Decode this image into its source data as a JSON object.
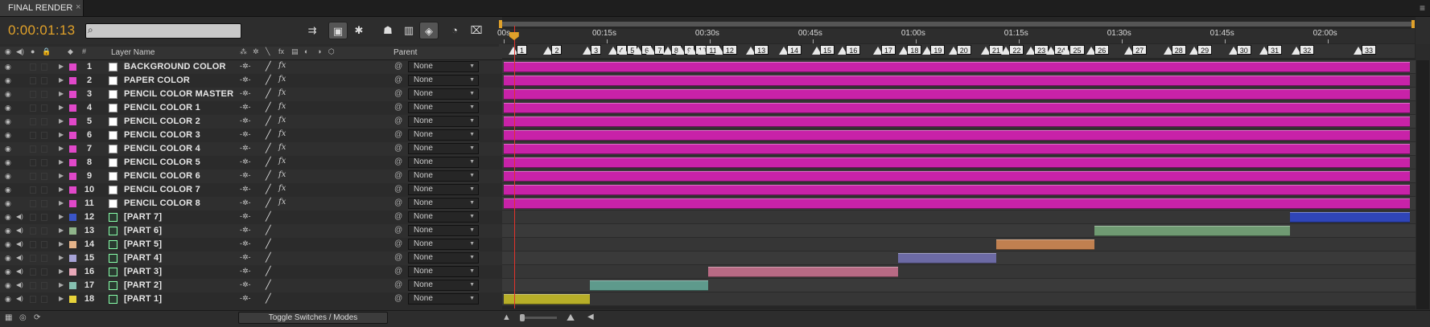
{
  "tab": {
    "title": "FINAL RENDER",
    "close": "×"
  },
  "panel_menu": "≡",
  "timecode": "0:00:01:13",
  "search": {
    "placeholder": ""
  },
  "columns": {
    "layer_name": "Layer Name",
    "parent": "Parent"
  },
  "toolbar": {
    "icons": [
      "comp-mini-flowchart-icon",
      "draft-3d-icon",
      "shy-icon",
      "frame-blending-icon",
      "motion-blur-icon",
      "brainstorm-icon",
      "graph-editor-icon"
    ]
  },
  "ruler": {
    "ticks": [
      "00s",
      "00:15s",
      "00:30s",
      "00:45s",
      "01:00s",
      "01:15s",
      "01:30s",
      "01:45s",
      "02:00s"
    ],
    "markers": [
      "1",
      "2",
      "3",
      "4",
      "5",
      "6",
      "7",
      "8",
      "9",
      "10",
      "11",
      "12",
      "13",
      "14",
      "15",
      "16",
      "17",
      "18",
      "19",
      "20",
      "21",
      "22",
      "23",
      "24",
      "25",
      "26",
      "27",
      "28",
      "29",
      "30",
      "31",
      "32",
      "33"
    ]
  },
  "layers": [
    {
      "num": "1",
      "name": "BACKGROUND COLOR",
      "label": "#e048c9",
      "type": "solid",
      "fx": "fx",
      "parent": "None"
    },
    {
      "num": "2",
      "name": "PAPER COLOR",
      "label": "#e048c9",
      "type": "solid",
      "fx": "fx",
      "parent": "None"
    },
    {
      "num": "3",
      "name": "PENCIL COLOR MASTER",
      "label": "#e048c9",
      "type": "solid",
      "fx": "fx",
      "parent": "None"
    },
    {
      "num": "4",
      "name": "PENCIL COLOR 1",
      "label": "#e048c9",
      "type": "solid",
      "fx": "fx",
      "parent": "None"
    },
    {
      "num": "5",
      "name": "PENCIL COLOR 2",
      "label": "#e048c9",
      "type": "solid",
      "fx": "fx",
      "parent": "None"
    },
    {
      "num": "6",
      "name": "PENCIL COLOR 3",
      "label": "#e048c9",
      "type": "solid",
      "fx": "fx",
      "parent": "None"
    },
    {
      "num": "7",
      "name": "PENCIL COLOR 4",
      "label": "#e048c9",
      "type": "solid",
      "fx": "fx",
      "parent": "None"
    },
    {
      "num": "8",
      "name": "PENCIL COLOR 5",
      "label": "#e048c9",
      "type": "solid",
      "fx": "fx",
      "parent": "None"
    },
    {
      "num": "9",
      "name": "PENCIL COLOR 6",
      "label": "#e048c9",
      "type": "solid",
      "fx": "fx",
      "parent": "None"
    },
    {
      "num": "10",
      "name": "PENCIL COLOR 7",
      "label": "#e048c9",
      "type": "solid",
      "fx": "fx",
      "parent": "None"
    },
    {
      "num": "11",
      "name": "PENCIL COLOR 8",
      "label": "#e048c9",
      "type": "solid",
      "fx": "fx",
      "parent": "None"
    },
    {
      "num": "12",
      "name": "[PART 7]",
      "label": "#3a55c8",
      "type": "comp",
      "fx": "",
      "parent": "None"
    },
    {
      "num": "13",
      "name": "[PART 6]",
      "label": "#8fb48a",
      "type": "comp",
      "fx": "",
      "parent": "None"
    },
    {
      "num": "14",
      "name": "[PART 5]",
      "label": "#e6b48a",
      "type": "comp",
      "fx": "",
      "parent": "None"
    },
    {
      "num": "15",
      "name": "[PART 4]",
      "label": "#a6a3d6",
      "type": "comp",
      "fx": "",
      "parent": "None"
    },
    {
      "num": "16",
      "name": "[PART 3]",
      "label": "#e8a8b8",
      "type": "comp",
      "fx": "",
      "parent": "None"
    },
    {
      "num": "17",
      "name": "[PART 2]",
      "label": "#86c0b0",
      "type": "comp",
      "fx": "",
      "parent": "None"
    },
    {
      "num": "18",
      "name": "[PART 1]",
      "label": "#e6d23a",
      "type": "comp",
      "fx": "",
      "parent": "None"
    }
  ],
  "bars": [
    {
      "layer": "1",
      "start": 0,
      "end": 132,
      "color": "#c822a8"
    },
    {
      "layer": "2",
      "start": 0,
      "end": 132,
      "color": "#c822a8"
    },
    {
      "layer": "3",
      "start": 0,
      "end": 132,
      "color": "#c822a8"
    },
    {
      "layer": "4",
      "start": 0,
      "end": 132,
      "color": "#c822a8"
    },
    {
      "layer": "5",
      "start": 0,
      "end": 132,
      "color": "#c822a8"
    },
    {
      "layer": "6",
      "start": 0,
      "end": 132,
      "color": "#c822a8"
    },
    {
      "layer": "7",
      "start": 0,
      "end": 132,
      "color": "#c822a8"
    },
    {
      "layer": "8",
      "start": 0,
      "end": 132,
      "color": "#c822a8"
    },
    {
      "layer": "9",
      "start": 0,
      "end": 132,
      "color": "#c822a8"
    },
    {
      "layer": "10",
      "start": 0,
      "end": 132,
      "color": "#c822a8"
    },
    {
      "layer": "11",
      "start": 0,
      "end": 132,
      "color": "#c822a8"
    },
    {
      "layer": "12",
      "start": 114.5,
      "end": 132,
      "color": "#2f45b8"
    },
    {
      "layer": "13",
      "start": 86,
      "end": 114.5,
      "color": "#6f9a72"
    },
    {
      "layer": "14",
      "start": 71.7,
      "end": 86,
      "color": "#c08050"
    },
    {
      "layer": "15",
      "start": 57.4,
      "end": 71.7,
      "color": "#6c6aa4"
    },
    {
      "layer": "16",
      "start": 29.8,
      "end": 57.4,
      "color": "#b86a84"
    },
    {
      "layer": "17",
      "start": 12.6,
      "end": 29.8,
      "color": "#5e9a8c"
    },
    {
      "layer": "18",
      "start": 0,
      "end": 12.6,
      "color": "#b7ae28"
    }
  ],
  "marker_times": [
    1.4,
    6.5,
    12.2,
    15.9,
    17.5,
    19.6,
    21.5,
    23.9,
    25.8,
    27.4,
    29.0,
    31.4,
    36.0,
    40.8,
    45.6,
    49.4,
    54.5,
    58.3,
    61.7,
    65.5,
    70.2,
    73.2,
    76.8,
    79.7,
    82.0,
    85.6,
    91.1,
    96.8,
    100.6,
    106.3,
    110.8,
    115.5,
    124.5
  ],
  "playhead_time": 1.5,
  "time_max": 132,
  "toggle_label": "Toggle Switches / Modes"
}
